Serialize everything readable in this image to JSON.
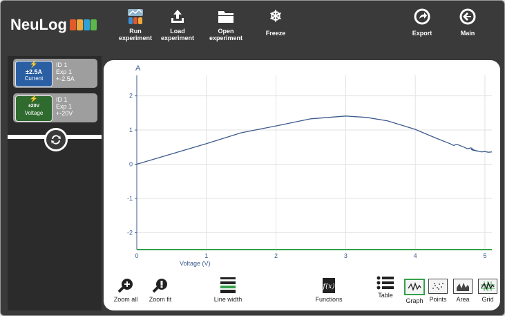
{
  "app": {
    "logo_text": "NeuLog",
    "logo_colors": [
      "#e05a2b",
      "#f2a93b",
      "#2fa0d8",
      "#5bb84a"
    ]
  },
  "toolbar": {
    "run_label": "Run\nexperiment",
    "load_label": "Load\nexperiment",
    "open_label": "Open\nexperiment",
    "freeze_label": "Freeze",
    "export_label": "Export",
    "main_label": "Main"
  },
  "sensors": [
    {
      "range": "±2.5A",
      "type": "Current",
      "id": "ID 1",
      "exp": "Exp 1",
      "info_range": "+-2.5A",
      "color": "#2b5fa4"
    },
    {
      "range": "±20V",
      "type": "Voltage",
      "id": "ID 1",
      "exp": "Exp 1",
      "info_range": "+-20V",
      "color": "#2f6a2f"
    }
  ],
  "bottom": {
    "zoom_all": "Zoom all",
    "zoom_fit": "Zoom fit",
    "line_width": "Line width",
    "functions": "Functions",
    "table": "Table",
    "graph": "Graph",
    "points": "Points",
    "area": "Area",
    "grid": "Grid"
  },
  "chart_data": {
    "type": "line",
    "ylabel": "A",
    "xlabel": "Voltage (V)",
    "xlim": [
      0,
      5.1
    ],
    "ylim": [
      -2.5,
      2.6
    ],
    "x_ticks": [
      0,
      1,
      2,
      3,
      4,
      5
    ],
    "y_ticks": [
      -2,
      -1,
      0,
      1,
      2
    ],
    "grid": true,
    "line_color": "#3a5a8a",
    "series": [
      {
        "x": [
          0,
          0.5,
          1.0,
          1.5,
          2.0,
          2.5,
          3.0,
          3.3,
          3.6,
          4.0,
          4.3,
          4.5,
          4.55,
          4.6,
          4.7,
          4.75,
          4.8,
          4.85,
          4.8,
          4.9,
          4.85,
          4.95,
          5.0,
          5.05,
          5.1
        ],
        "y": [
          0.0,
          0.3,
          0.6,
          0.92,
          1.12,
          1.33,
          1.41,
          1.37,
          1.27,
          1.02,
          0.76,
          0.6,
          0.55,
          0.58,
          0.5,
          0.45,
          0.48,
          0.4,
          0.43,
          0.38,
          0.41,
          0.36,
          0.37,
          0.35,
          0.36
        ]
      }
    ]
  }
}
